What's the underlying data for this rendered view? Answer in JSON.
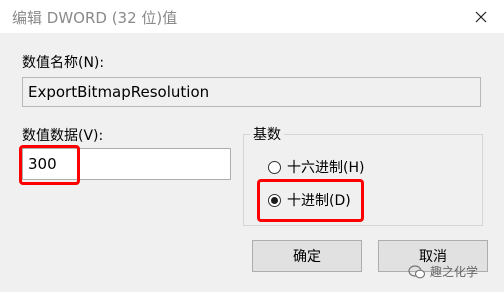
{
  "window": {
    "title": "编辑 DWORD (32 位)值",
    "close_glyph": "✕"
  },
  "value_name": {
    "label": "数值名称(N):",
    "value": "ExportBitmapResolution"
  },
  "value_data": {
    "label": "数值数据(V):",
    "value": "300"
  },
  "base": {
    "title": "基数",
    "options": [
      {
        "label": "十六进制(H)",
        "checked": false
      },
      {
        "label": "十进制(D)",
        "checked": true
      }
    ]
  },
  "buttons": {
    "ok": "确定",
    "cancel": "取消"
  },
  "watermark": {
    "text": "趣之化学",
    "icon": "wechat-official-account-icon"
  },
  "colors": {
    "highlight": "#ff0000",
    "title_text": "#8a8a8a"
  }
}
